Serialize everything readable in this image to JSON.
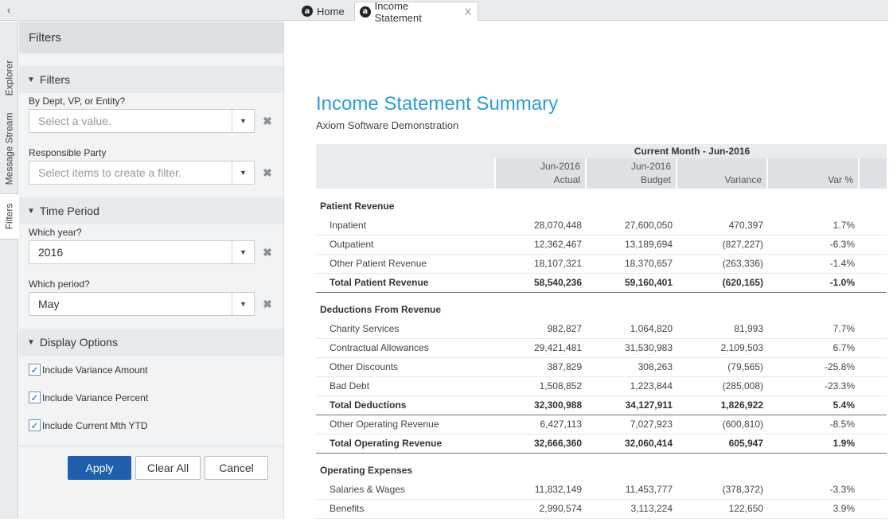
{
  "tabs": {
    "collapse_glyph": "‹",
    "logo_letter": "a",
    "items": [
      {
        "label": "Home"
      },
      {
        "label": "Income Statement",
        "close": "X"
      }
    ]
  },
  "rail": {
    "items": [
      {
        "label": "Explorer"
      },
      {
        "label": "Message Stream"
      },
      {
        "label": "Filters"
      }
    ]
  },
  "filters_panel": {
    "title": "Filters",
    "sections": {
      "filters": {
        "heading": "Filters",
        "fields": [
          {
            "label": "By Dept, VP, or Entity?",
            "placeholder": "Select a value."
          },
          {
            "label": "Responsible Party",
            "placeholder": "Select items to create a filter."
          }
        ]
      },
      "time_period": {
        "heading": "Time Period",
        "fields": [
          {
            "label": "Which year?",
            "value": "2016"
          },
          {
            "label": "Which period?",
            "value": "May"
          }
        ]
      },
      "display_options": {
        "heading": "Display Options",
        "checkboxes": [
          {
            "label": "Include Variance Amount",
            "checked": true
          },
          {
            "label": "Include Variance Percent",
            "checked": true
          },
          {
            "label": "Include Current Mth YTD",
            "checked": true
          }
        ]
      }
    },
    "buttons": {
      "apply": "Apply",
      "clear_all": "Clear All",
      "cancel": "Cancel"
    },
    "clear_glyph": "✖",
    "check_glyph": "✓"
  },
  "report": {
    "title": "Income Statement Summary",
    "subtitle": "Axiom Software Demonstration",
    "header_group": "Current Month - Jun-2016",
    "columns": [
      {
        "line1": "Jun-2016",
        "line2": "Actual"
      },
      {
        "line1": "Jun-2016",
        "line2": "Budget"
      },
      {
        "line1": "",
        "line2": "Variance"
      },
      {
        "line1": "",
        "line2": "Var %"
      }
    ],
    "groups": [
      {
        "heading": "Patient Revenue",
        "rows": [
          {
            "label": "Inpatient",
            "actual": "28,070,448",
            "budget": "27,600,050",
            "variance": "470,397",
            "pct": "1.7%"
          },
          {
            "label": "Outpatient",
            "actual": "12,362,467",
            "budget": "13,189,694",
            "variance": "(827,227)",
            "pct": "-6.3%"
          },
          {
            "label": "Other Patient Revenue",
            "actual": "18,107,321",
            "budget": "18,370,657",
            "variance": "(263,336)",
            "pct": "-1.4%"
          }
        ],
        "total": {
          "label": "Total Patient Revenue",
          "actual": "58,540,236",
          "budget": "59,160,401",
          "variance": "(620,165)",
          "pct": "-1.0%"
        }
      },
      {
        "heading": "Deductions From Revenue",
        "rows": [
          {
            "label": "Charity Services",
            "actual": "982,827",
            "budget": "1,064,820",
            "variance": "81,993",
            "pct": "7.7%"
          },
          {
            "label": "Contractual Allowances",
            "actual": "29,421,481",
            "budget": "31,530,983",
            "variance": "2,109,503",
            "pct": "6.7%"
          },
          {
            "label": "Other Discounts",
            "actual": "387,829",
            "budget": "308,263",
            "variance": "(79,565)",
            "pct": "-25.8%"
          },
          {
            "label": "Bad Debt",
            "actual": "1,508,852",
            "budget": "1,223,844",
            "variance": "(285,008)",
            "pct": "-23.3%"
          }
        ],
        "total": {
          "label": "Total Deductions",
          "actual": "32,300,988",
          "budget": "34,127,911",
          "variance": "1,826,922",
          "pct": "5.4%"
        },
        "after_total": {
          "label": "Other Operating Revenue",
          "actual": "6,427,113",
          "budget": "7,027,923",
          "variance": "(600,810)",
          "pct": "-8.5%"
        },
        "total2": {
          "label": "Total Operating Revenue",
          "actual": "32,666,360",
          "budget": "32,060,414",
          "variance": "605,947",
          "pct": "1.9%"
        }
      },
      {
        "heading": "Operating Expenses",
        "rows": [
          {
            "label": "Salaries & Wages",
            "actual": "11,832,149",
            "budget": "11,453,777",
            "variance": "(378,372)",
            "pct": "-3.3%"
          },
          {
            "label": "Benefits",
            "actual": "2,990,574",
            "budget": "3,113,224",
            "variance": "122,650",
            "pct": "3.9%"
          }
        ]
      }
    ]
  }
}
